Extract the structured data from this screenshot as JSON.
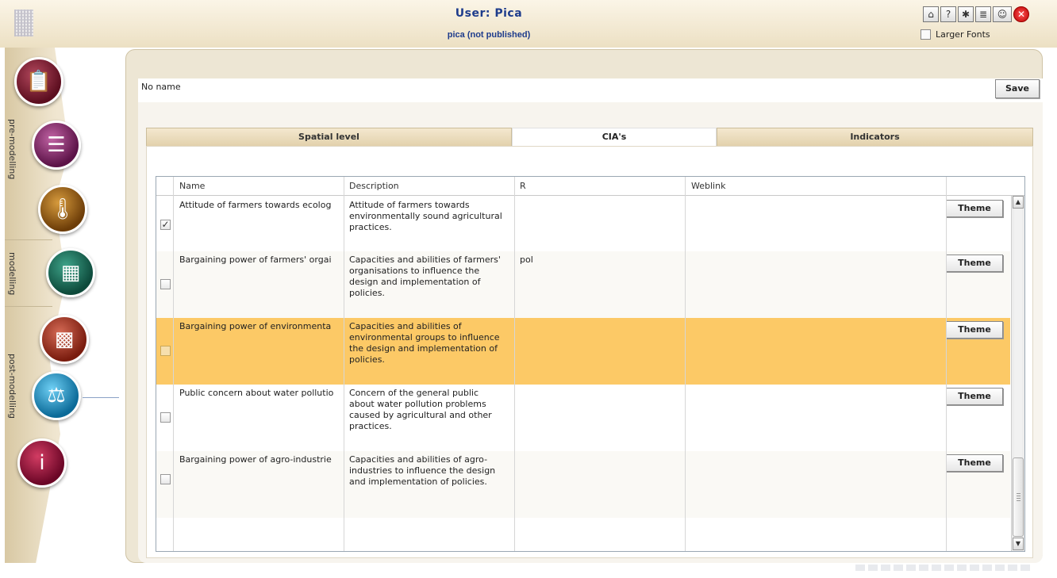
{
  "header": {
    "title": "User: Pica",
    "subtitle": "pica (not published)",
    "larger_fonts_label": "Larger Fonts",
    "icons": [
      "home-icon",
      "help-icon",
      "bug-icon",
      "book-icon",
      "users-icon",
      "close-icon"
    ]
  },
  "sidebar": {
    "sections": [
      "pre-modelling",
      "modelling",
      "post-modelling"
    ],
    "items": [
      {
        "name": "clipboard-icon",
        "color": "#7a1c33"
      },
      {
        "name": "books-icon",
        "color": "#8a2a6c"
      },
      {
        "name": "thermometer-icon",
        "color": "#a06414"
      },
      {
        "name": "calculator-icon",
        "color": "#1c6e5a"
      },
      {
        "name": "chart-icon",
        "color": "#a3361f"
      },
      {
        "name": "scales-icon",
        "color": "#1d8bc4"
      },
      {
        "name": "info-icon",
        "color": "#9c1038"
      }
    ]
  },
  "form": {
    "name_value": "No name",
    "save_label": "Save"
  },
  "tabs": [
    {
      "label": "Spatial level",
      "active": false
    },
    {
      "label": "CIA's",
      "active": true
    },
    {
      "label": "Indicators",
      "active": false
    }
  ],
  "table": {
    "columns": [
      "Name",
      "Description",
      "R",
      "Weblink",
      ""
    ],
    "theme_label": "Theme",
    "rows": [
      {
        "checked": true,
        "selected": false,
        "name": "Attitude of farmers towards ecolog",
        "description": "Attitude of farmers towards environmentally sound agricultural practices.",
        "desc_lines": [
          "Attitude of farmers towards",
          "environmentally sound agricultural",
          "practices."
        ],
        "r": "",
        "weblink": ""
      },
      {
        "checked": false,
        "selected": false,
        "name": "Bargaining power of farmers' orgai",
        "description": "Capacities and abilities of farmers' organisations to influence the design and implementation of policies.",
        "desc_lines": [
          "Capacities and abilities of farmers'",
          "organisations to influence the",
          "design and implementation of",
          "policies."
        ],
        "r": "pol",
        "weblink": ""
      },
      {
        "checked": false,
        "selected": true,
        "name": "Bargaining power of environmenta",
        "description": "Capacities and abilities of environmental groups to influence the design and implementation of policies.",
        "desc_lines": [
          "Capacities and abilities of",
          "environmental groups to influence",
          "the design and implementation of",
          "policies."
        ],
        "r": "",
        "weblink": ""
      },
      {
        "checked": false,
        "selected": false,
        "name": "Public concern about water pollutio",
        "description": "Concern of the general public about water pollution problems caused by agricultural and other practices.",
        "desc_lines": [
          "Concern of the general public",
          "about water pollution problems",
          "caused by agricultural and other",
          "practices."
        ],
        "r": "",
        "weblink": ""
      },
      {
        "checked": false,
        "selected": false,
        "name": "Bargaining power of agro-industrie",
        "description": "Capacities and abilities of agro-industries to influence the design and implementation of policies.",
        "desc_lines": [
          "Capacities and abilities of agro-",
          "industries to influence the design",
          "and implementation of policies."
        ],
        "r": "",
        "weblink": ""
      }
    ]
  },
  "colors": {
    "title": "#1e3c8c",
    "selected_row": "#fcc966",
    "panel": "#ede6d4"
  }
}
